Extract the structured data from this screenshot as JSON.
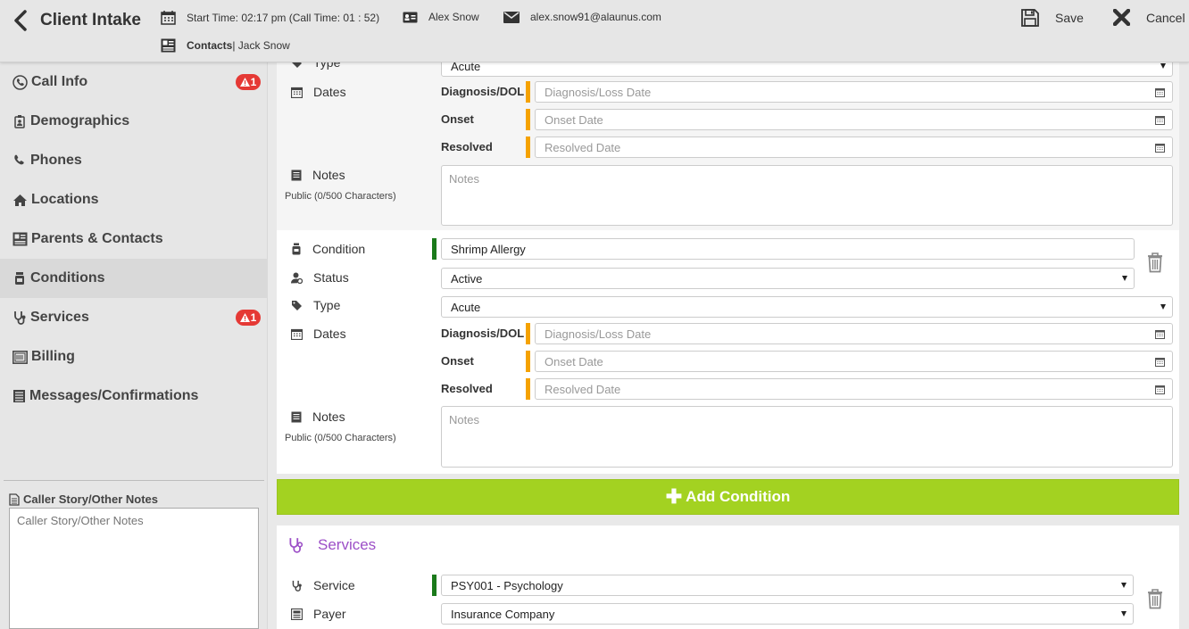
{
  "header": {
    "title": "Client Intake",
    "start_time": "Start Time: 02:17 pm (Call Time: 01 : 52)",
    "client_name": "Alex Snow",
    "email": "alex.snow91@alaunus.com",
    "contacts_label": "Contacts",
    "contacts_value": " | Jack Snow",
    "save_label": "Save",
    "cancel_label": "Cancel"
  },
  "sidebar": {
    "items": [
      {
        "label": "Call Info",
        "badge": "1",
        "icon": "phone-circle-icon"
      },
      {
        "label": "Demographics",
        "icon": "id-badge-icon"
      },
      {
        "label": "Phones",
        "icon": "phone-icon"
      },
      {
        "label": "Locations",
        "icon": "home-icon"
      },
      {
        "label": "Parents & Contacts",
        "icon": "contact-card-icon"
      },
      {
        "label": "Conditions",
        "icon": "condition-icon",
        "active": true
      },
      {
        "label": "Services",
        "badge": "1",
        "icon": "stethoscope-icon"
      },
      {
        "label": "Billing",
        "icon": "bill-icon"
      },
      {
        "label": "Messages/Confirmations",
        "icon": "list-icon"
      }
    ],
    "caller_story_label": "Caller Story/Other Notes",
    "caller_story_placeholder": "Caller Story/Other Notes"
  },
  "condition_prev": {
    "type_label": "Type",
    "type_value": "Acute",
    "dates_label": "Dates",
    "diagnosis_label": "Diagnosis/DOL",
    "diagnosis_placeholder": "Diagnosis/Loss Date",
    "onset_label": "Onset",
    "onset_placeholder": "Onset Date",
    "resolved_label": "Resolved",
    "resolved_placeholder": "Resolved Date",
    "notes_label": "Notes",
    "notes_sub": "Public (0/500 Characters)",
    "notes_placeholder": "Notes"
  },
  "condition": {
    "condition_label": "Condition",
    "condition_value": "Shrimp Allergy",
    "status_label": "Status",
    "status_value": "Active",
    "type_label": "Type",
    "type_value": "Acute",
    "dates_label": "Dates",
    "diagnosis_label": "Diagnosis/DOL",
    "diagnosis_placeholder": "Diagnosis/Loss Date",
    "onset_label": "Onset",
    "onset_placeholder": "Onset Date",
    "resolved_label": "Resolved",
    "resolved_placeholder": "Resolved Date",
    "notes_label": "Notes",
    "notes_sub": "Public (0/500 Characters)",
    "notes_placeholder": "Notes"
  },
  "add_condition_label": "Add Condition",
  "services": {
    "title": "Services",
    "service_label": "Service",
    "service_value": "PSY001 - Psychology",
    "payer_label": "Payer",
    "payer_value": "Insurance Company"
  },
  "colors": {
    "required": "#f5a200",
    "valid": "#1b7a1b",
    "add_button": "#a3d221",
    "badge": "#e53935",
    "section_title": "#9c4fc7"
  }
}
